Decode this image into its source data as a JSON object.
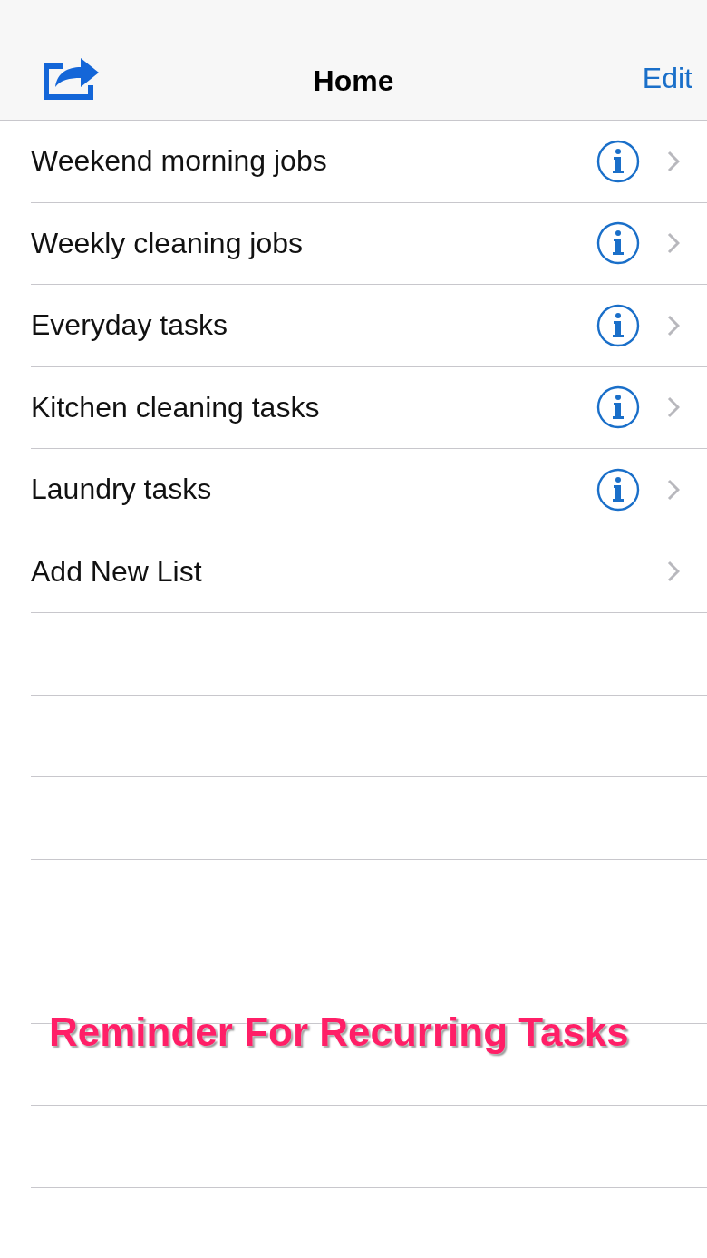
{
  "nav": {
    "title": "Home",
    "edit": "Edit"
  },
  "lists": [
    {
      "name": "Weekend morning jobs",
      "info": true
    },
    {
      "name": "Weekly cleaning jobs",
      "info": true
    },
    {
      "name": "Everyday tasks",
      "info": true
    },
    {
      "name": "Kitchen cleaning tasks",
      "info": true
    },
    {
      "name": "Laundry tasks",
      "info": true
    },
    {
      "name": "Add New List",
      "info": false
    }
  ],
  "caption": "Reminder For Recurring Tasks"
}
